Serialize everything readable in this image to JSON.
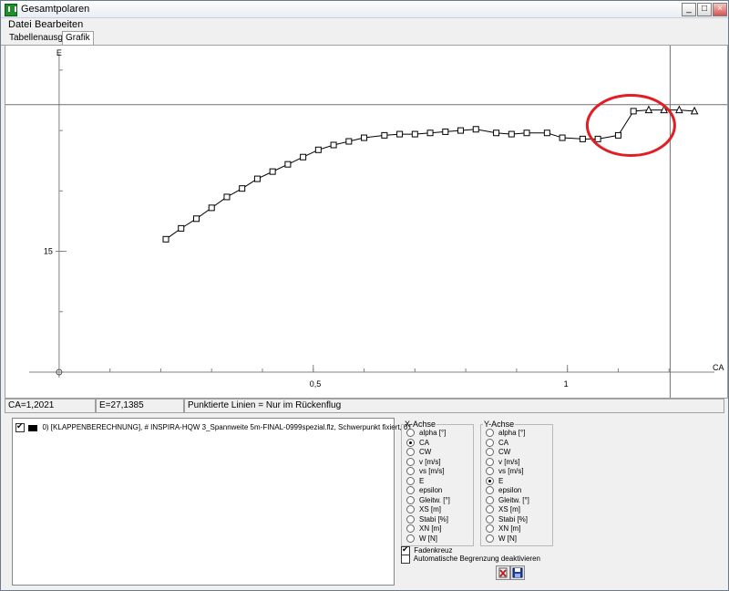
{
  "window": {
    "title": "Gesamtpolaren",
    "controls": [
      "_",
      "□",
      "×"
    ]
  },
  "menu": [
    "Datei",
    "Bearbeiten"
  ],
  "tabs": [
    {
      "label": "Tabellenausgabe",
      "active": false
    },
    {
      "label": "Grafik",
      "active": true
    }
  ],
  "chart_data": {
    "type": "line",
    "xlabel": "CA",
    "ylabel": "E",
    "xlim": [
      -0.05,
      1.3
    ],
    "ylim": [
      5,
      31.5
    ],
    "x_ticks": [
      {
        "value": 0.5,
        "label": "0,5"
      },
      {
        "value": 1.0,
        "label": "1"
      }
    ],
    "y_ticks": [
      {
        "value": 15,
        "label": "15"
      }
    ],
    "crosshair": {
      "x": 1.2021,
      "y": 27.1385
    },
    "marker_square_until_index": 29,
    "series": [
      {
        "x": [
          0.21,
          0.24,
          0.27,
          0.3,
          0.33,
          0.36,
          0.39,
          0.42,
          0.45,
          0.48,
          0.51,
          0.54,
          0.57,
          0.6,
          0.64,
          0.67,
          0.7,
          0.73,
          0.76,
          0.79,
          0.82,
          0.86,
          0.89,
          0.92,
          0.96,
          0.99,
          1.03,
          1.06,
          1.1,
          1.13,
          1.16,
          1.19,
          1.22,
          1.25
        ],
        "y": [
          16.0,
          16.9,
          17.7,
          18.6,
          19.5,
          20.2,
          21.0,
          21.6,
          22.2,
          22.8,
          23.4,
          23.8,
          24.1,
          24.4,
          24.6,
          24.7,
          24.7,
          24.8,
          24.9,
          25.0,
          25.1,
          24.8,
          24.7,
          24.8,
          24.8,
          24.4,
          24.3,
          24.3,
          24.6,
          26.6,
          26.7,
          26.7,
          26.7,
          26.6
        ]
      }
    ],
    "annotation": {
      "shape": "ellipse",
      "color": "#e01e24"
    }
  },
  "status": {
    "ca": "CA=1,2021",
    "e": "E=27,1385",
    "note": "Punktierte Linien = Nur im Rückenflug"
  },
  "series_list": [
    {
      "checked": true,
      "color": "#000000",
      "label": "0) [KLAPPENBERECHNUNG], # INSPIRA-HQW 3_Spannweite 5m-FINAL-0999spezial.flz, Schwerpunkt fixiert, 01"
    }
  ],
  "x_axis": {
    "title": "X-Achse",
    "options": [
      "alpha [°]",
      "CA",
      "CW",
      "v [m/s]",
      "vs [m/s]",
      "E",
      "epsilon",
      "Gleitw. [°]",
      "XS [m]",
      "Stabi [%]",
      "XN [m]",
      "W [N]"
    ],
    "selected": "CA"
  },
  "y_axis": {
    "title": "Y-Achse",
    "options": [
      "alpha [°]",
      "CA",
      "CW",
      "v [m/s]",
      "vs [m/s]",
      "E",
      "epsilon",
      "Gleitw. [°]",
      "XS [m]",
      "Stabi [%]",
      "XN [m]",
      "W [N]"
    ],
    "selected": "E"
  },
  "options": {
    "crosshair_label": "Fadenkreuz",
    "crosshair_checked": true,
    "autolimit_label": "Automatische Begrenzung deaktivieren",
    "autolimit_checked": false
  },
  "toolbar": [
    "export-icon",
    "save-icon"
  ]
}
